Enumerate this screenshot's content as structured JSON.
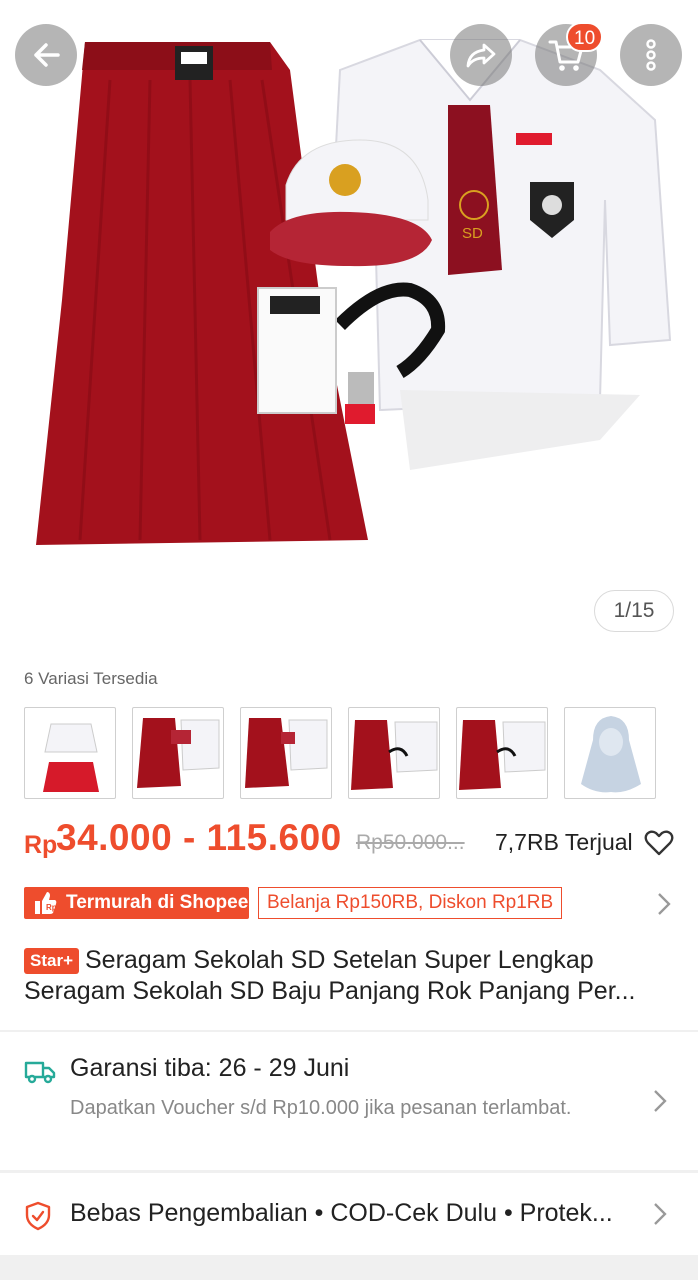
{
  "header": {
    "cart_count": "10",
    "image_counter": "1/15"
  },
  "variations": {
    "label": "6 Variasi Tersedia"
  },
  "price": {
    "currency": "Rp",
    "range": "34.000 - 115.600",
    "original": "Rp50.000...",
    "sold": "7,7RB Terjual"
  },
  "badges": {
    "cheapest": "Termurah di Shopee",
    "voucher": "Belanja Rp150RB, Diskon Rp1RB"
  },
  "product": {
    "star_badge": "Star+",
    "title_line1": "Seragam Sekolah SD Setelan Super Lengkap",
    "title_line2": "Seragam Sekolah SD Baju Panjang Rok Panjang Per..."
  },
  "shipping": {
    "title": "Garansi tiba: 26 - 29 Juni",
    "subtitle": "Dapatkan Voucher s/d Rp10.000 jika pesanan terlambat."
  },
  "returns": {
    "text": "Bebas Pengembalian  •  COD-Cek Dulu  •  Protek..."
  },
  "colors": {
    "accent": "#ee4d2d",
    "skirt_red": "#a3111c",
    "shipping_icon": "#26aa99"
  },
  "icons": [
    "back-arrow-icon",
    "share-icon",
    "cart-icon",
    "more-vertical-icon",
    "heart-icon",
    "thumbs-up-icon",
    "chevron-right-icon",
    "truck-icon",
    "shield-icon"
  ]
}
